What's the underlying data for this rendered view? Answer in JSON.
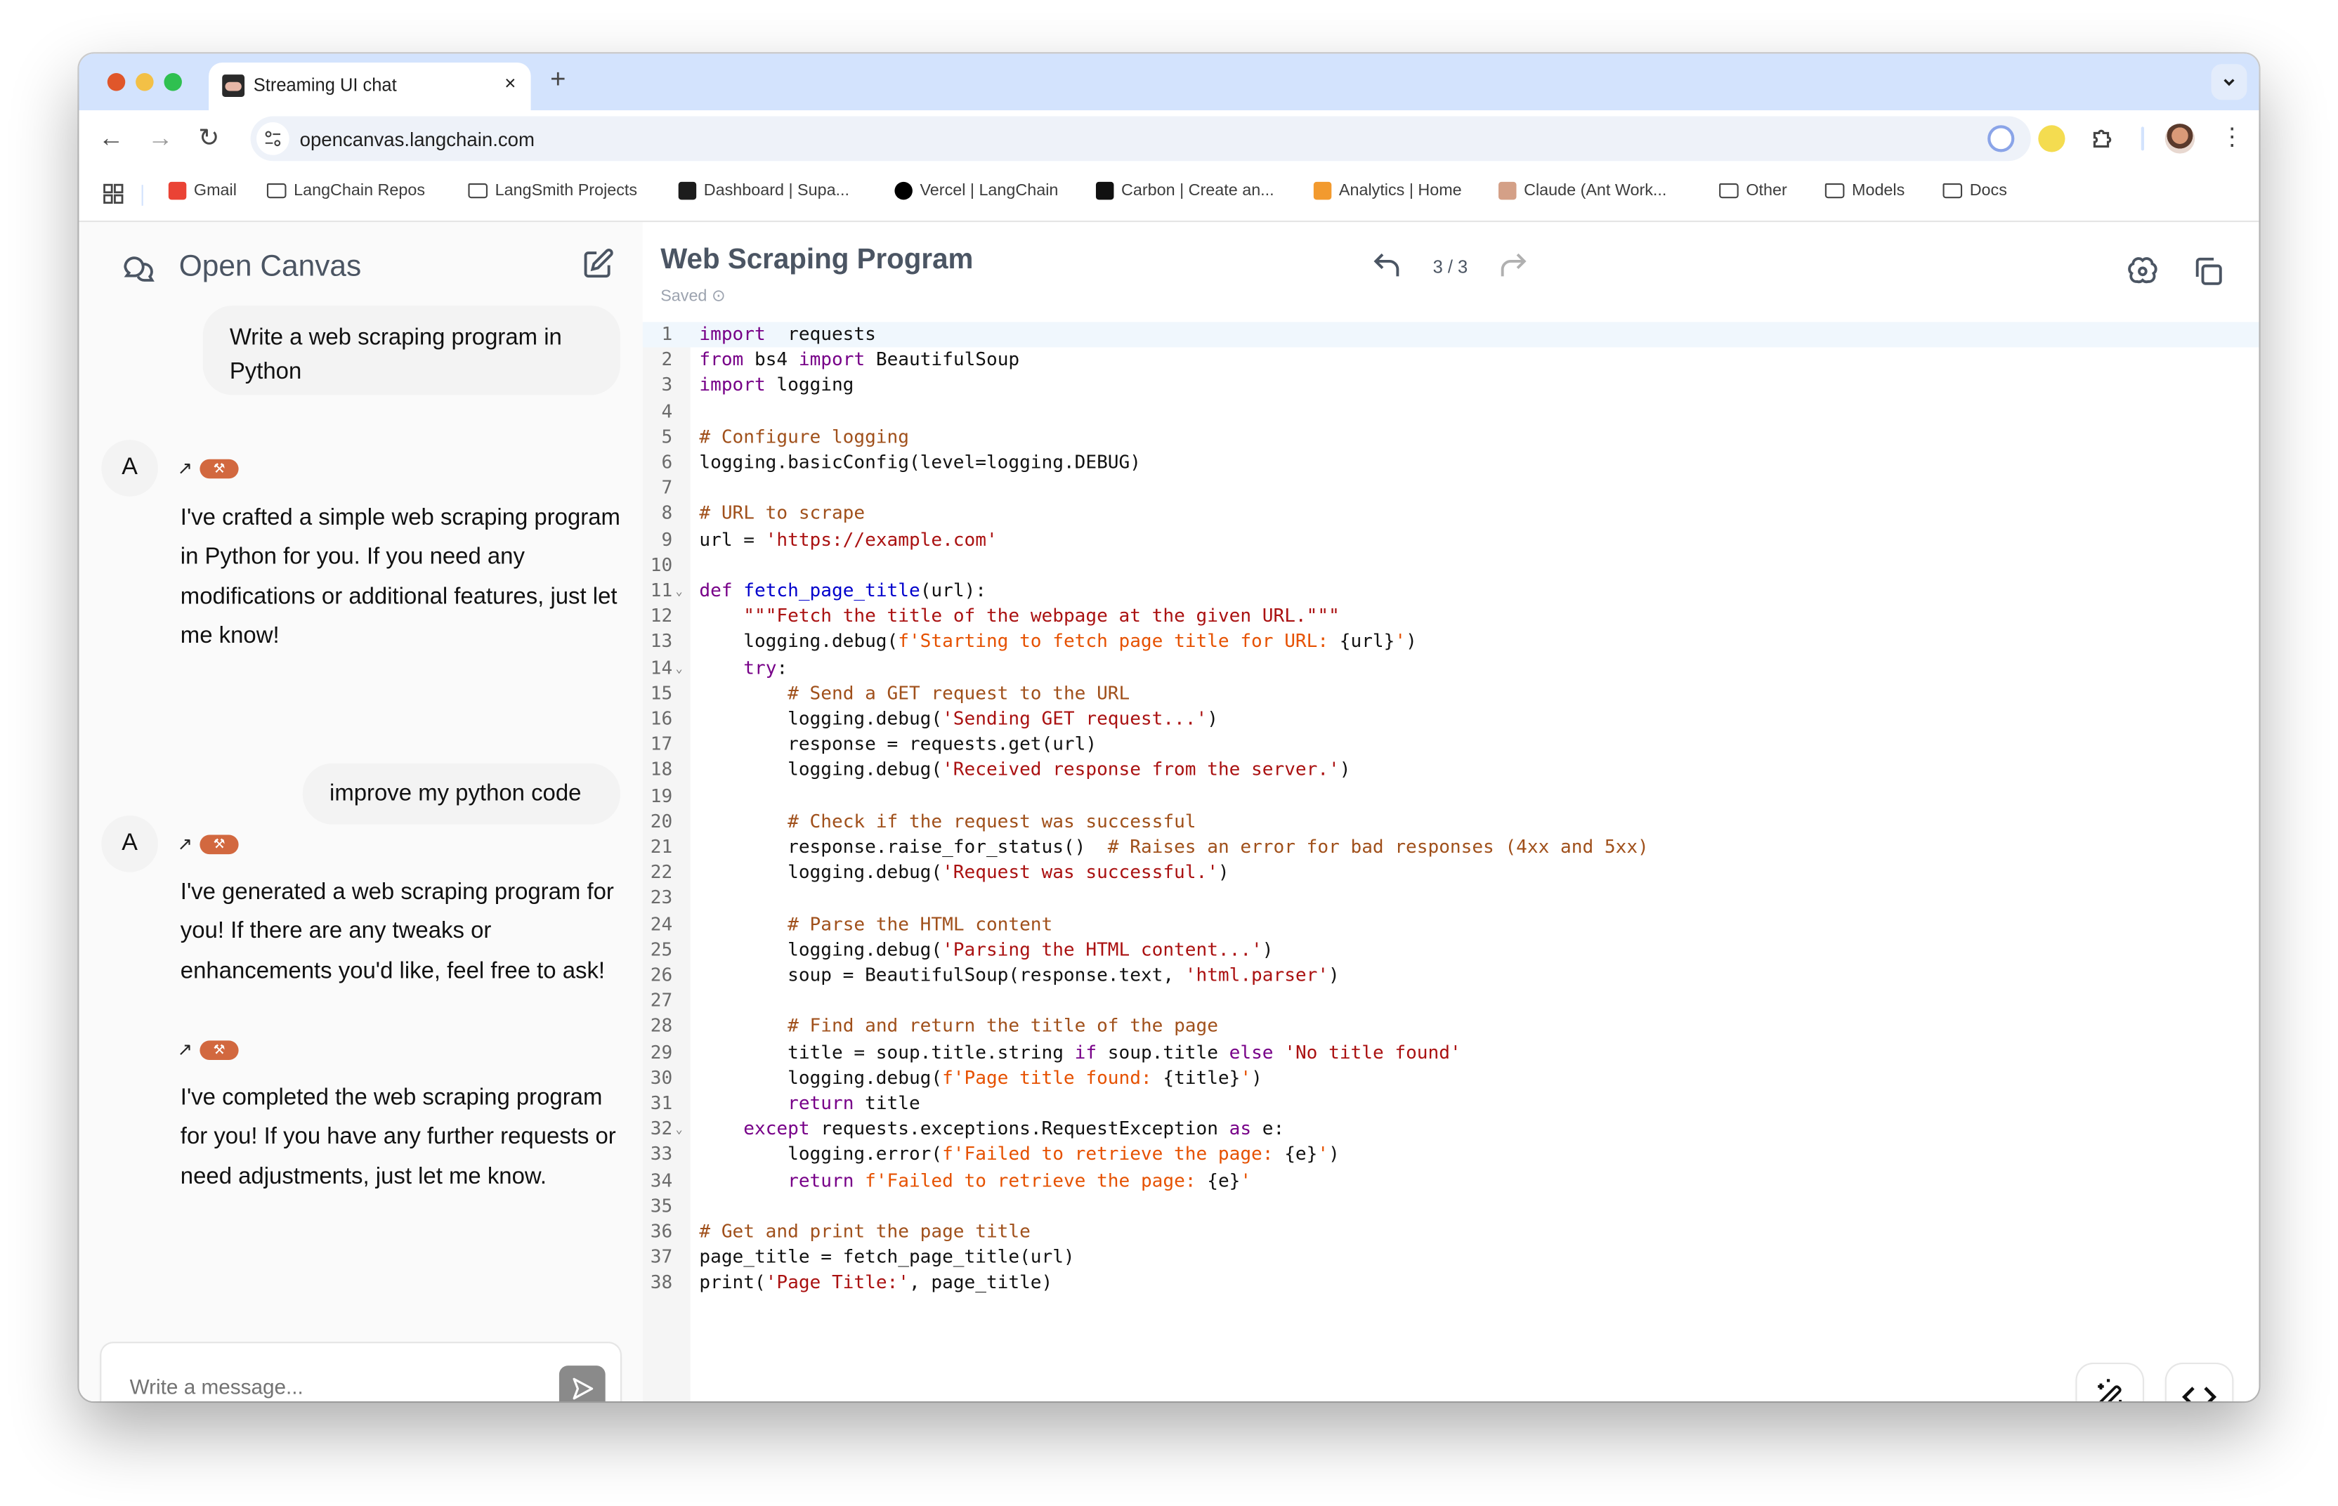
{
  "browser": {
    "tab_title": "Streaming UI chat",
    "tab_close": "×",
    "new_tab": "+",
    "tab_menu": "⌄",
    "url": "opencanvas.langchain.com",
    "nav": {
      "back": "←",
      "forward": "→",
      "reload": "↻"
    },
    "kebab": "⋮",
    "apps_icon": "▦",
    "bookmarks": [
      {
        "label": "Gmail",
        "icon": "gmail-icon"
      },
      {
        "label": "LangChain Repos",
        "icon": "folder-icon"
      },
      {
        "label": "LangSmith Projects",
        "icon": "folder-icon"
      },
      {
        "label": "Dashboard | Supa...",
        "icon": "supabase-icon"
      },
      {
        "label": "Vercel | LangChain",
        "icon": "vercel-icon"
      },
      {
        "label": "Carbon | Create an...",
        "icon": "carbon-icon"
      },
      {
        "label": "Analytics | Home",
        "icon": "analytics-icon"
      },
      {
        "label": "Claude (Ant Work...",
        "icon": "anthropic-icon"
      },
      {
        "label": "Other",
        "icon": "folder-icon"
      },
      {
        "label": "Models",
        "icon": "folder-icon"
      },
      {
        "label": "Docs",
        "icon": "folder-icon"
      }
    ]
  },
  "chat": {
    "app_title": "Open Canvas",
    "messages": [
      {
        "role": "user",
        "text": "Write a web scraping program in Python"
      },
      {
        "role": "assistant",
        "avatar": "A",
        "text": "I've crafted a simple web scraping program in Python for you. If you need any modifications or additional features, just let me know!"
      },
      {
        "role": "user",
        "text": "improve my python code"
      },
      {
        "role": "assistant",
        "avatar": "A",
        "text": "I've generated a web scraping program for you! If there are any tweaks or enhancements you'd like, feel free to ask!"
      },
      {
        "role": "assistant",
        "avatar": "",
        "text": "I've completed the web scraping program for you! If you have any further requests or need adjustments, just let me know."
      }
    ],
    "input_placeholder": "Write a message...",
    "input_value": ""
  },
  "editor": {
    "title": "Web Scraping Program",
    "status": "Saved",
    "version_current": 3,
    "version_total": 3,
    "version_label": "3 / 3",
    "undo": "↶",
    "redo": "↷",
    "active_line": 1,
    "code_lines": [
      [
        [
          "kw",
          "import"
        ],
        [
          "",
          "  requests"
        ]
      ],
      [
        [
          "kw",
          "from"
        ],
        [
          "",
          " bs4 "
        ],
        [
          "kw",
          "import"
        ],
        [
          "",
          " BeautifulSoup"
        ]
      ],
      [
        [
          "kw",
          "import"
        ],
        [
          "",
          " logging"
        ]
      ],
      [],
      [
        [
          "cm",
          "# Configure logging"
        ]
      ],
      [
        [
          "",
          "logging.basicConfig(level=logging.DEBUG)"
        ]
      ],
      [],
      [
        [
          "cm",
          "# URL to scrape"
        ]
      ],
      [
        [
          "",
          "url = "
        ],
        [
          "str",
          "'https://example.com'"
        ]
      ],
      [],
      [
        [
          "kw",
          "def"
        ],
        [
          "",
          " "
        ],
        [
          "fn",
          "fetch_page_title"
        ],
        [
          "",
          "(url):"
        ]
      ],
      [
        [
          "",
          "    "
        ],
        [
          "str",
          "\"\"\"Fetch the title of the webpage at the given URL.\"\"\""
        ]
      ],
      [
        [
          "",
          "    logging.debug("
        ],
        [
          "fstr",
          "f'Starting to fetch page title for URL: "
        ],
        [
          "",
          "{url}"
        ],
        [
          "fstr",
          "'"
        ],
        [
          "",
          ")"
        ]
      ],
      [
        [
          "",
          "    "
        ],
        [
          "kw",
          "try"
        ],
        [
          "",
          ":"
        ]
      ],
      [
        [
          "",
          "        "
        ],
        [
          "cm",
          "# Send a GET request to the URL"
        ]
      ],
      [
        [
          "",
          "        logging.debug("
        ],
        [
          "str",
          "'Sending GET request...'"
        ],
        [
          "",
          ")"
        ]
      ],
      [
        [
          "",
          "        response = requests.get(url)"
        ]
      ],
      [
        [
          "",
          "        logging.debug("
        ],
        [
          "str",
          "'Received response from the server.'"
        ],
        [
          "",
          ")"
        ]
      ],
      [],
      [
        [
          "",
          "        "
        ],
        [
          "cm",
          "# Check if the request was successful"
        ]
      ],
      [
        [
          "",
          "        response.raise_for_status()  "
        ],
        [
          "cm",
          "# Raises an error for bad responses (4xx and 5xx)"
        ]
      ],
      [
        [
          "",
          "        logging.debug("
        ],
        [
          "str",
          "'Request was successful.'"
        ],
        [
          "",
          ")"
        ]
      ],
      [],
      [
        [
          "",
          "        "
        ],
        [
          "cm",
          "# Parse the HTML content"
        ]
      ],
      [
        [
          "",
          "        logging.debug("
        ],
        [
          "str",
          "'Parsing the HTML content...'"
        ],
        [
          "",
          ")"
        ]
      ],
      [
        [
          "",
          "        soup = BeautifulSoup(response.text, "
        ],
        [
          "str",
          "'html.parser'"
        ],
        [
          "",
          ")"
        ]
      ],
      [],
      [
        [
          "",
          "        "
        ],
        [
          "cm",
          "# Find and return the title of the page"
        ]
      ],
      [
        [
          "",
          "        title = soup.title.string "
        ],
        [
          "kw",
          "if"
        ],
        [
          "",
          " soup.title "
        ],
        [
          "kw",
          "else"
        ],
        [
          "",
          " "
        ],
        [
          "str",
          "'No title found'"
        ]
      ],
      [
        [
          "",
          "        logging.debug("
        ],
        [
          "fstr",
          "f'Page title found: "
        ],
        [
          "",
          "{title}"
        ],
        [
          "fstr",
          "'"
        ],
        [
          "",
          ")"
        ]
      ],
      [
        [
          "",
          "        "
        ],
        [
          "kw",
          "return"
        ],
        [
          "",
          " title"
        ]
      ],
      [
        [
          "",
          "    "
        ],
        [
          "kw",
          "except"
        ],
        [
          "",
          " requests.exceptions.RequestException "
        ],
        [
          "kw",
          "as"
        ],
        [
          "",
          " e:"
        ]
      ],
      [
        [
          "",
          "        logging.error("
        ],
        [
          "fstr",
          "f'Failed to retrieve the page: "
        ],
        [
          "",
          "{e}"
        ],
        [
          "fstr",
          "'"
        ],
        [
          "",
          ")"
        ]
      ],
      [
        [
          "",
          "        "
        ],
        [
          "kw",
          "return"
        ],
        [
          "",
          " "
        ],
        [
          "fstr",
          "f'Failed to retrieve the page: "
        ],
        [
          "",
          "{e}"
        ],
        [
          "fstr",
          "'"
        ]
      ],
      [],
      [
        [
          "cm",
          "# Get and print the page title"
        ]
      ],
      [
        [
          "",
          "page_title = fetch_page_title(url)"
        ]
      ],
      [
        [
          "",
          "print("
        ],
        [
          "str",
          "'Page Title:'"
        ],
        [
          "",
          ", page_title)"
        ]
      ]
    ],
    "fold_lines": [
      11,
      14,
      32
    ]
  },
  "colors": {
    "badge": "#d2683f",
    "keyword": "#770088",
    "string": "#aa1111",
    "fstring": "#e65100",
    "comment": "#a0501b",
    "function": "#0000cc"
  }
}
